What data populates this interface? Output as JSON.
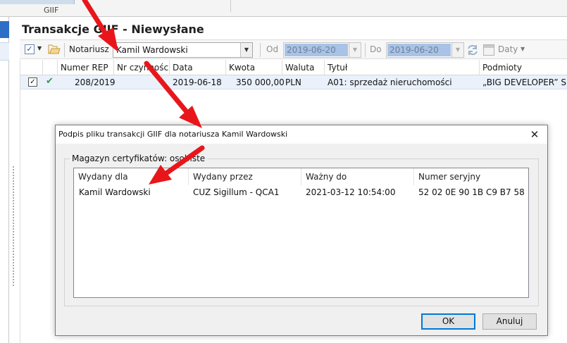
{
  "ribbon": {
    "group_label": "GIIF"
  },
  "main": {
    "title": "Transakcje GIIF - Niewysłane"
  },
  "toolbar": {
    "notary_label": "Notariusz",
    "notary_value": "Kamil Wardowski",
    "from_label": "Od",
    "from_value": "2019-06-20",
    "to_label": "Do",
    "to_value": "2019-06-20",
    "dates_label": "Daty"
  },
  "grid": {
    "columns": [
      "Numer REP",
      "Nr czynności",
      "Data",
      "Kwota",
      "Waluta",
      "Tytuł",
      "Podmioty"
    ],
    "rows": [
      {
        "numer_rep": "208/2019",
        "nr_czynnosci": "",
        "data": "2019-06-18",
        "kwota": "350 000,00",
        "waluta": "PLN",
        "tytul": "A01: sprzedaż nieruchomości",
        "podmioty": "„BIG DEVELOPER” Spółka"
      }
    ]
  },
  "dialog": {
    "title": "Podpis pliku transakcji GIIF dla notariusza Kamil Wardowski",
    "group_label": "Magazyn certyfikatów: osobiste",
    "columns": [
      "Wydany dla",
      "Wydany przez",
      "Ważny do",
      "Numer seryjny"
    ],
    "rows": [
      {
        "wydany_dla": "Kamil Wardowski",
        "wydany_przez": "CUZ Sigillum - QCA1",
        "wazny_do": "2021-03-12 10:54:00",
        "numer_seryjny": "52 02 0E 90 1B C9 B7 58"
      }
    ],
    "ok_label": "OK",
    "cancel_label": "Anuluj"
  },
  "colors": {
    "selection": "#eaf1fb",
    "disabled_field": "#a9c3e6",
    "annotation_arrow": "#e8161b",
    "ok_check": "#2e9a4e"
  },
  "icons": [
    "checkbox-icon",
    "folder-icon",
    "refresh-icon",
    "calendar-icon",
    "check-icon",
    "close-icon",
    "chevron-down-icon",
    "annotation-arrow"
  ]
}
